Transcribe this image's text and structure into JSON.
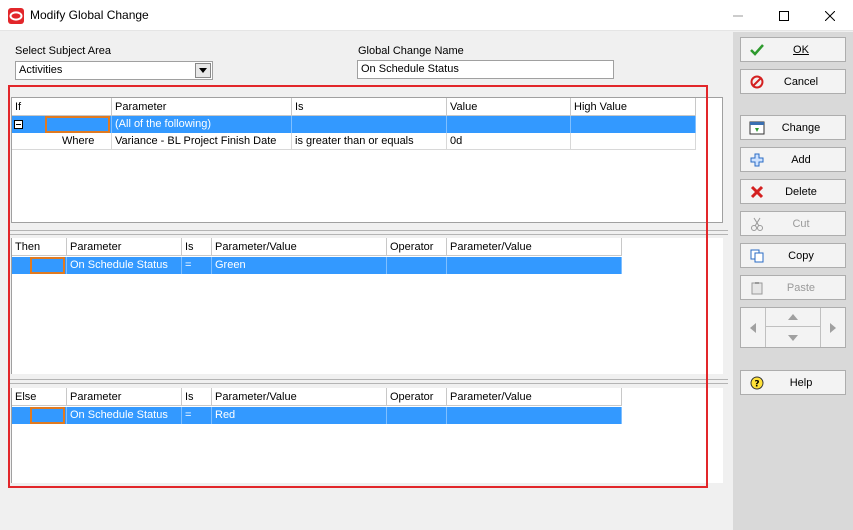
{
  "window": {
    "title": "Modify Global Change"
  },
  "form": {
    "subject_area_label": "Select Subject Area",
    "subject_area_value": "Activities",
    "name_label": "Global Change Name",
    "name_value": "On Schedule Status"
  },
  "if_grid": {
    "headers": [
      "If",
      "Parameter",
      "Is",
      "Value",
      "High Value"
    ],
    "rows": [
      {
        "if": "",
        "parameter": "(All of the following)",
        "is": "",
        "value": "",
        "high": ""
      },
      {
        "if": "Where",
        "parameter": "Variance - BL Project Finish Date",
        "is": "is greater than or equals",
        "value": "0d",
        "high": ""
      }
    ]
  },
  "then_grid": {
    "headers": [
      "Then",
      "Parameter",
      "Is",
      "Parameter/Value",
      "Operator",
      "Parameter/Value"
    ],
    "rows": [
      {
        "parameter": "On Schedule Status",
        "is": "=",
        "value": "Green",
        "operator": "",
        "value2": ""
      }
    ]
  },
  "else_grid": {
    "headers": [
      "Else",
      "Parameter",
      "Is",
      "Parameter/Value",
      "Operator",
      "Parameter/Value"
    ],
    "rows": [
      {
        "parameter": "On Schedule Status",
        "is": "=",
        "value": "Red",
        "operator": "",
        "value2": ""
      }
    ]
  },
  "toolbar": {
    "ok": "OK",
    "cancel": "Cancel",
    "change": "Change",
    "add": "Add",
    "delete": "Delete",
    "cut": "Cut",
    "copy": "Copy",
    "paste": "Paste",
    "help": "Help"
  },
  "colors": {
    "selection": "#3399ff",
    "highlight_border": "#e2262a",
    "focus_cell": "#e07a20"
  }
}
